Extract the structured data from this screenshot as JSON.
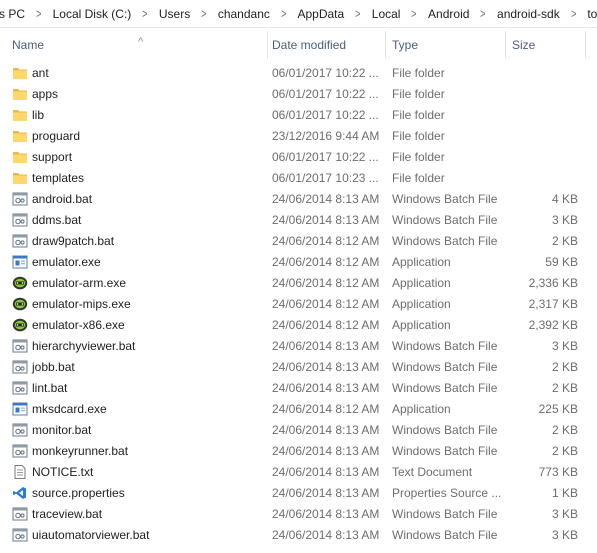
{
  "breadcrumb": [
    "s PC",
    "Local Disk (C:)",
    "Users",
    "chandanc",
    "AppData",
    "Local",
    "Android",
    "android-sdk",
    "tools"
  ],
  "columns": {
    "name": "Name",
    "date": "Date modified",
    "type": "Type",
    "size": "Size"
  },
  "sort_indicator": "^",
  "files": [
    {
      "name": "ant",
      "date": "06/01/2017 10:22 ...",
      "type": "File folder",
      "size": "",
      "icon": "folder-icon"
    },
    {
      "name": "apps",
      "date": "06/01/2017 10:22 ...",
      "type": "File folder",
      "size": "",
      "icon": "folder-icon"
    },
    {
      "name": "lib",
      "date": "06/01/2017 10:22 ...",
      "type": "File folder",
      "size": "",
      "icon": "folder-icon"
    },
    {
      "name": "proguard",
      "date": "23/12/2016 9:44 AM",
      "type": "File folder",
      "size": "",
      "icon": "folder-icon"
    },
    {
      "name": "support",
      "date": "06/01/2017 10:22 ...",
      "type": "File folder",
      "size": "",
      "icon": "folder-icon"
    },
    {
      "name": "templates",
      "date": "06/01/2017 10:23 ...",
      "type": "File folder",
      "size": "",
      "icon": "folder-icon"
    },
    {
      "name": "android.bat",
      "date": "24/06/2014 8:13 AM",
      "type": "Windows Batch File",
      "size": "4 KB",
      "icon": "batch-file-icon"
    },
    {
      "name": "ddms.bat",
      "date": "24/06/2014 8:13 AM",
      "type": "Windows Batch File",
      "size": "3 KB",
      "icon": "batch-file-icon"
    },
    {
      "name": "draw9patch.bat",
      "date": "24/06/2014 8:12 AM",
      "type": "Windows Batch File",
      "size": "2 KB",
      "icon": "batch-file-icon"
    },
    {
      "name": "emulator.exe",
      "date": "24/06/2014 8:12 AM",
      "type": "Application",
      "size": "59 KB",
      "icon": "application-icon"
    },
    {
      "name": "emulator-arm.exe",
      "date": "24/06/2014 8:12 AM",
      "type": "Application",
      "size": "2,336 KB",
      "icon": "emulator-app-icon"
    },
    {
      "name": "emulator-mips.exe",
      "date": "24/06/2014 8:12 AM",
      "type": "Application",
      "size": "2,317 KB",
      "icon": "emulator-app-icon"
    },
    {
      "name": "emulator-x86.exe",
      "date": "24/06/2014 8:12 AM",
      "type": "Application",
      "size": "2,392 KB",
      "icon": "emulator-app-icon"
    },
    {
      "name": "hierarchyviewer.bat",
      "date": "24/06/2014 8:13 AM",
      "type": "Windows Batch File",
      "size": "3 KB",
      "icon": "batch-file-icon"
    },
    {
      "name": "jobb.bat",
      "date": "24/06/2014 8:13 AM",
      "type": "Windows Batch File",
      "size": "2 KB",
      "icon": "batch-file-icon"
    },
    {
      "name": "lint.bat",
      "date": "24/06/2014 8:13 AM",
      "type": "Windows Batch File",
      "size": "2 KB",
      "icon": "batch-file-icon"
    },
    {
      "name": "mksdcard.exe",
      "date": "24/06/2014 8:12 AM",
      "type": "Application",
      "size": "225 KB",
      "icon": "application-icon"
    },
    {
      "name": "monitor.bat",
      "date": "24/06/2014 8:13 AM",
      "type": "Windows Batch File",
      "size": "2 KB",
      "icon": "batch-file-icon"
    },
    {
      "name": "monkeyrunner.bat",
      "date": "24/06/2014 8:13 AM",
      "type": "Windows Batch File",
      "size": "2 KB",
      "icon": "batch-file-icon"
    },
    {
      "name": "NOTICE.txt",
      "date": "24/06/2014 8:13 AM",
      "type": "Text Document",
      "size": "773 KB",
      "icon": "text-document-icon"
    },
    {
      "name": "source.properties",
      "date": "24/06/2014 8:13 AM",
      "type": "Properties Source ...",
      "size": "1 KB",
      "icon": "vscode-properties-icon"
    },
    {
      "name": "traceview.bat",
      "date": "24/06/2014 8:13 AM",
      "type": "Windows Batch File",
      "size": "3 KB",
      "icon": "batch-file-icon"
    },
    {
      "name": "uiautomatorviewer.bat",
      "date": "24/06/2014 8:13 AM",
      "type": "Windows Batch File",
      "size": "3 KB",
      "icon": "batch-file-icon"
    }
  ]
}
